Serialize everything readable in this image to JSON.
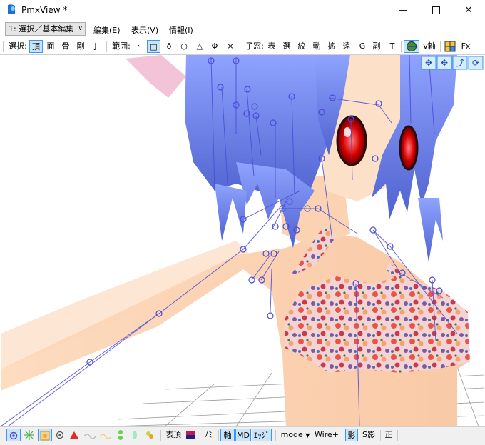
{
  "window": {
    "title": "PmxView *"
  },
  "menu": {
    "mode_select": "1: 選択／基本編集",
    "items": [
      "編集(E)",
      "表示(V)",
      "情報(I)"
    ]
  },
  "toolbar": {
    "select_label": "選択:",
    "select_items": [
      "頂",
      "面",
      "骨",
      "剛",
      "J"
    ],
    "range_label": "範囲:",
    "range_items": [
      "・",
      "□",
      "δ",
      "○",
      "△",
      "Φ",
      "×"
    ],
    "child_label": "子窓:",
    "child_items": [
      "表",
      "選",
      "絞",
      "動",
      "拡",
      "遠",
      "G",
      "副",
      "T"
    ],
    "axis_label": "v軸",
    "fx_label": "Fx"
  },
  "bottom": {
    "table_vertex": "表頂",
    "mi_label": "ﾉﾐ",
    "axis": "軸",
    "md": "MD",
    "edge": "ｴｯｼﾞ",
    "mode": "mode",
    "wire": "Wire+",
    "shadow": "影",
    "sshadow": "S影",
    "front": "正"
  },
  "colors": {
    "hair": "#7b8fe0",
    "skin": "#fcd9bc",
    "bone": "#4a4ad8",
    "accent": "#3399ff"
  }
}
